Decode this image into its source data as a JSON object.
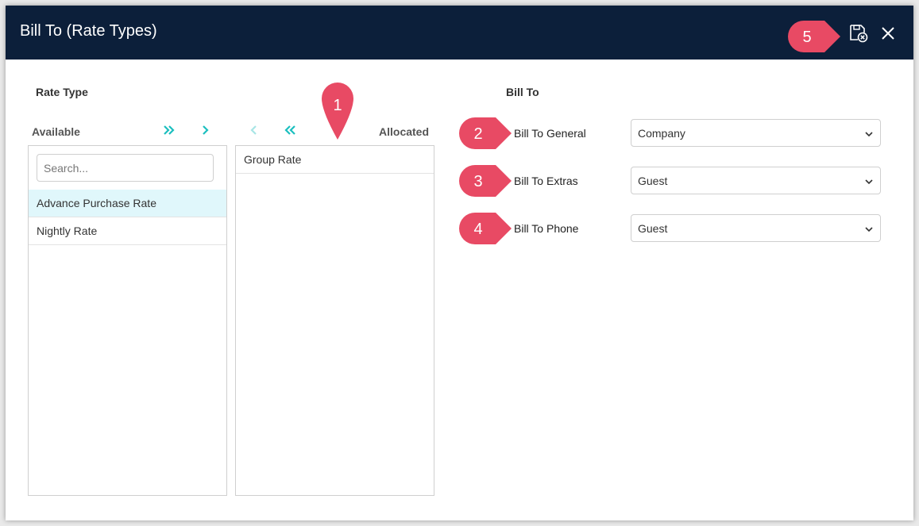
{
  "dialog": {
    "title": "Bill To (Rate Types)",
    "colors": {
      "titlebar": "#0c1f3a",
      "accent": "#1cbfbf",
      "callout": "#e84a64",
      "selected_row": "#e0f7fb"
    }
  },
  "rate_type": {
    "heading": "Rate Type",
    "available_label": "Available",
    "allocated_label": "Allocated",
    "search_placeholder": "Search...",
    "available_items": [
      "Advance Purchase Rate",
      "Nightly Rate"
    ],
    "allocated_items": [
      "Group Rate"
    ],
    "icons": [
      "move-all-right-icon",
      "move-right-icon",
      "move-left-icon",
      "move-all-left-icon"
    ]
  },
  "bill_to": {
    "heading": "Bill To",
    "fields": [
      {
        "label": "Bill To General",
        "value": "Company"
      },
      {
        "label": "Bill To Extras",
        "value": "Guest"
      },
      {
        "label": "Bill To Phone",
        "value": "Guest"
      }
    ]
  },
  "callouts": [
    "1",
    "2",
    "3",
    "4",
    "5"
  ]
}
